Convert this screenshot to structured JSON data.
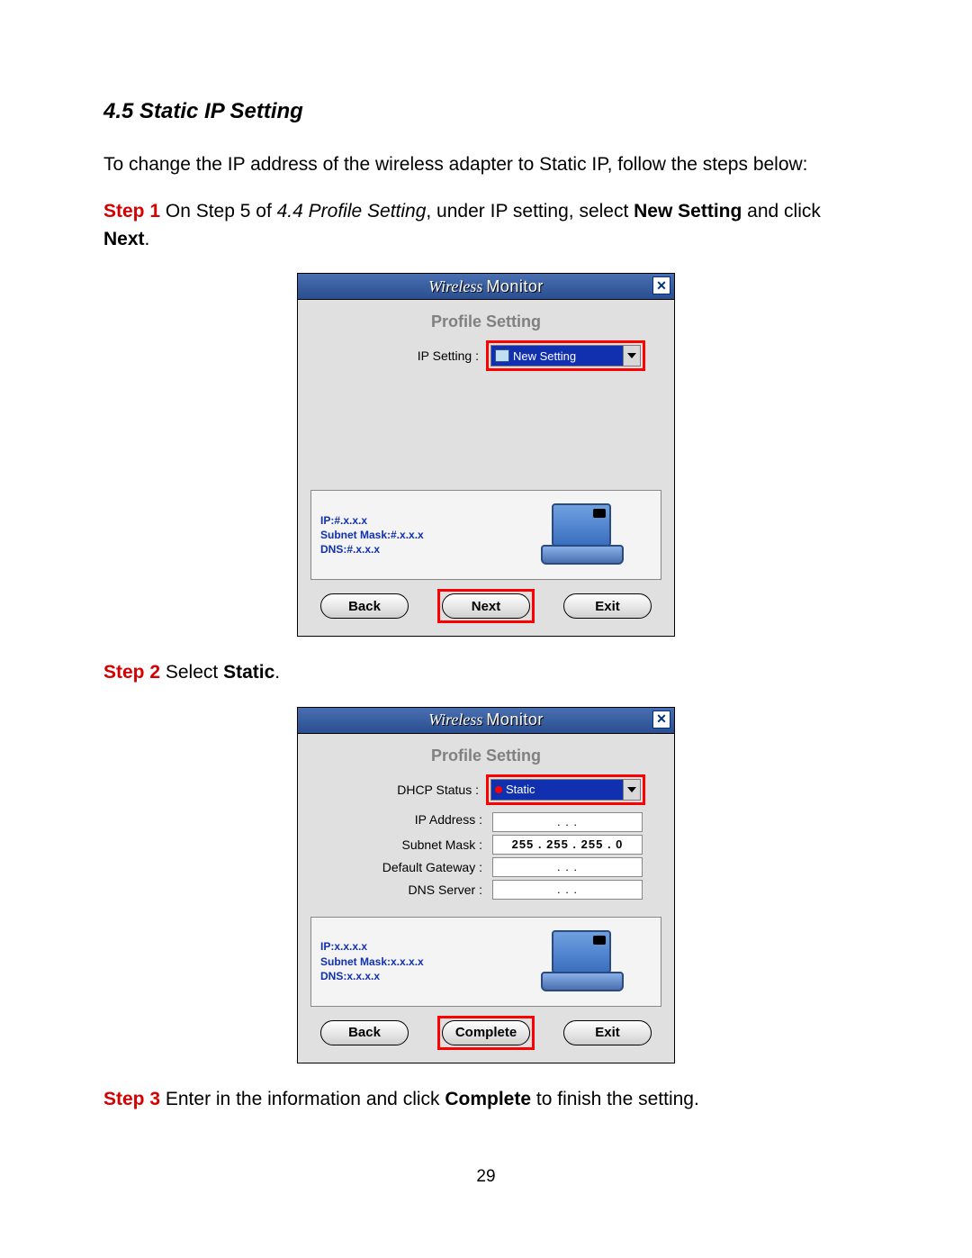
{
  "section_title": "4.5 Static IP Setting",
  "intro": "To change the IP address of the wireless adapter to Static IP, follow the steps below:",
  "step1": {
    "label": "Step 1",
    "text_a": " On Step 5 of ",
    "ref": "4.4 Profile Setting",
    "text_b": ", under IP setting, select ",
    "bold1": "New Setting",
    "text_c": " and click ",
    "bold2": "Next",
    "text_d": "."
  },
  "step2": {
    "label": "Step 2",
    "text_a": " Select ",
    "bold1": "Static",
    "text_b": "."
  },
  "step3": {
    "label": "Step 3",
    "text_a": " Enter in the information and click ",
    "bold1": "Complete",
    "text_b": " to finish the setting."
  },
  "dlg1": {
    "title_a": "Wireless",
    "title_b": "Monitor",
    "subheader": "Profile Setting",
    "ip_label": "IP Setting :",
    "ip_value": "New Setting",
    "info1": "IP:#.x.x.x",
    "info2": "Subnet Mask:#.x.x.x",
    "info3": "DNS:#.x.x.x",
    "btn_back": "Back",
    "btn_next": "Next",
    "btn_exit": "Exit"
  },
  "dlg2": {
    "title_a": "Wireless",
    "title_b": "Monitor",
    "subheader": "Profile Setting",
    "dhcp_label": "DHCP Status :",
    "dhcp_value": "Static",
    "ipa_label": "IP Address :",
    "ipa_value": " .       .       . ",
    "sub_label": "Subnet Mask :",
    "sub_value": "255 . 255 . 255 .  0",
    "gw_label": "Default Gateway :",
    "gw_value": " .       .       . ",
    "dns_label": "DNS Server :",
    "dns_value": " .       .       . ",
    "info1": "IP:x.x.x.x",
    "info2": "Subnet Mask:x.x.x.x",
    "info3": "DNS:x.x.x.x",
    "btn_back": "Back",
    "btn_complete": "Complete",
    "btn_exit": "Exit"
  },
  "page_number": "29"
}
